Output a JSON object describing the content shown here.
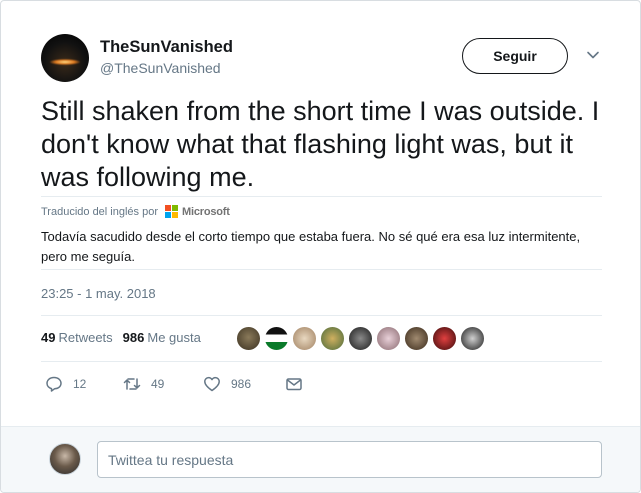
{
  "user": {
    "display_name": "TheSunVanished",
    "handle": "@TheSunVanished"
  },
  "follow_button": {
    "label": "Seguir"
  },
  "tweet": {
    "text": "Still shaken from the short time I was outside. I don't know what that flashing light was, but it was following me."
  },
  "translation": {
    "attribution": "Traducido del inglés por",
    "provider": "Microsoft",
    "text": "Todavía sacudido desde el corto tiempo que estaba fuera. No sé qué era esa luz intermitente, pero me seguía."
  },
  "timestamp": "23:25 - 1 may. 2018",
  "stats": {
    "retweets_count": "49",
    "retweets_label": "Retweets",
    "likes_count": "986",
    "likes_label": "Me gusta"
  },
  "likers": [
    {
      "name": "liker-1",
      "color": "#6b5a3a"
    },
    {
      "name": "liker-2",
      "color": "#b22222"
    },
    {
      "name": "liker-3",
      "color": "#c8b89a"
    },
    {
      "name": "liker-4",
      "color": "#8a9a5a"
    },
    {
      "name": "liker-5",
      "color": "#3a3a3a"
    },
    {
      "name": "liker-6",
      "color": "#c9a0a8"
    },
    {
      "name": "liker-7",
      "color": "#5a4a3a"
    },
    {
      "name": "liker-8",
      "color": "#b03030"
    },
    {
      "name": "liker-9",
      "color": "#2a2a2a"
    }
  ],
  "actions": {
    "reply_count": "12",
    "retweet_count": "49",
    "like_count": "986"
  },
  "reply_box": {
    "placeholder": "Twittea tu respuesta"
  },
  "colors": {
    "text_primary": "#14171a",
    "text_secondary": "#657786",
    "footer_bg": "#f5f8fa"
  }
}
